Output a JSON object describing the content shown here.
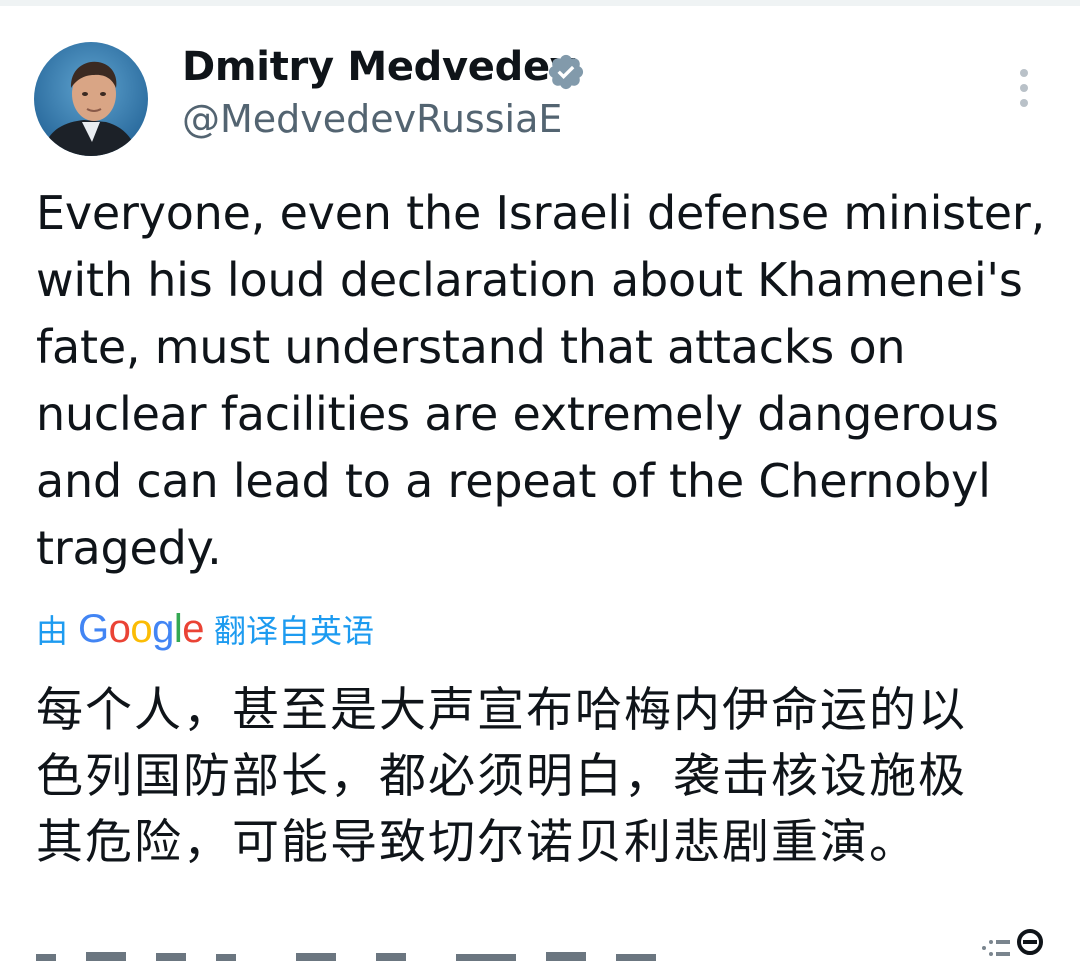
{
  "tweet": {
    "author": {
      "display_name": "Dmitry Medvedev",
      "handle": "@MedvedevRussiaE",
      "verified": true
    },
    "text": "Everyone, even the Israeli defense minister,\nwith his loud declaration about Khamenei's\nfate, must understand that attacks on\nnuclear facilities are extremely dangerous\nand can lead to a repeat of the Chernobyl\ntragedy.",
    "translation": {
      "prefix": "由",
      "provider": "Google",
      "suffix": "翻译自英语",
      "text": "每个人，甚至是大声宣布哈梅内伊命运的以\n色列国防部长，都必须明白，袭击核设施极\n其危险，可能导致切尔诺贝利悲剧重演。"
    }
  },
  "colors": {
    "text": "#0f1419",
    "secondary_text": "#536471",
    "link_blue": "#1d9bf0",
    "verified_badge": "#829aab",
    "google_blue": "#4285F4",
    "google_red": "#EA4335",
    "google_yellow": "#FBBC05",
    "google_green": "#34A853"
  },
  "icons": {
    "verified": "verified-badge-icon",
    "more": "more-vertical-icon",
    "bottom": "view-details-icon"
  }
}
